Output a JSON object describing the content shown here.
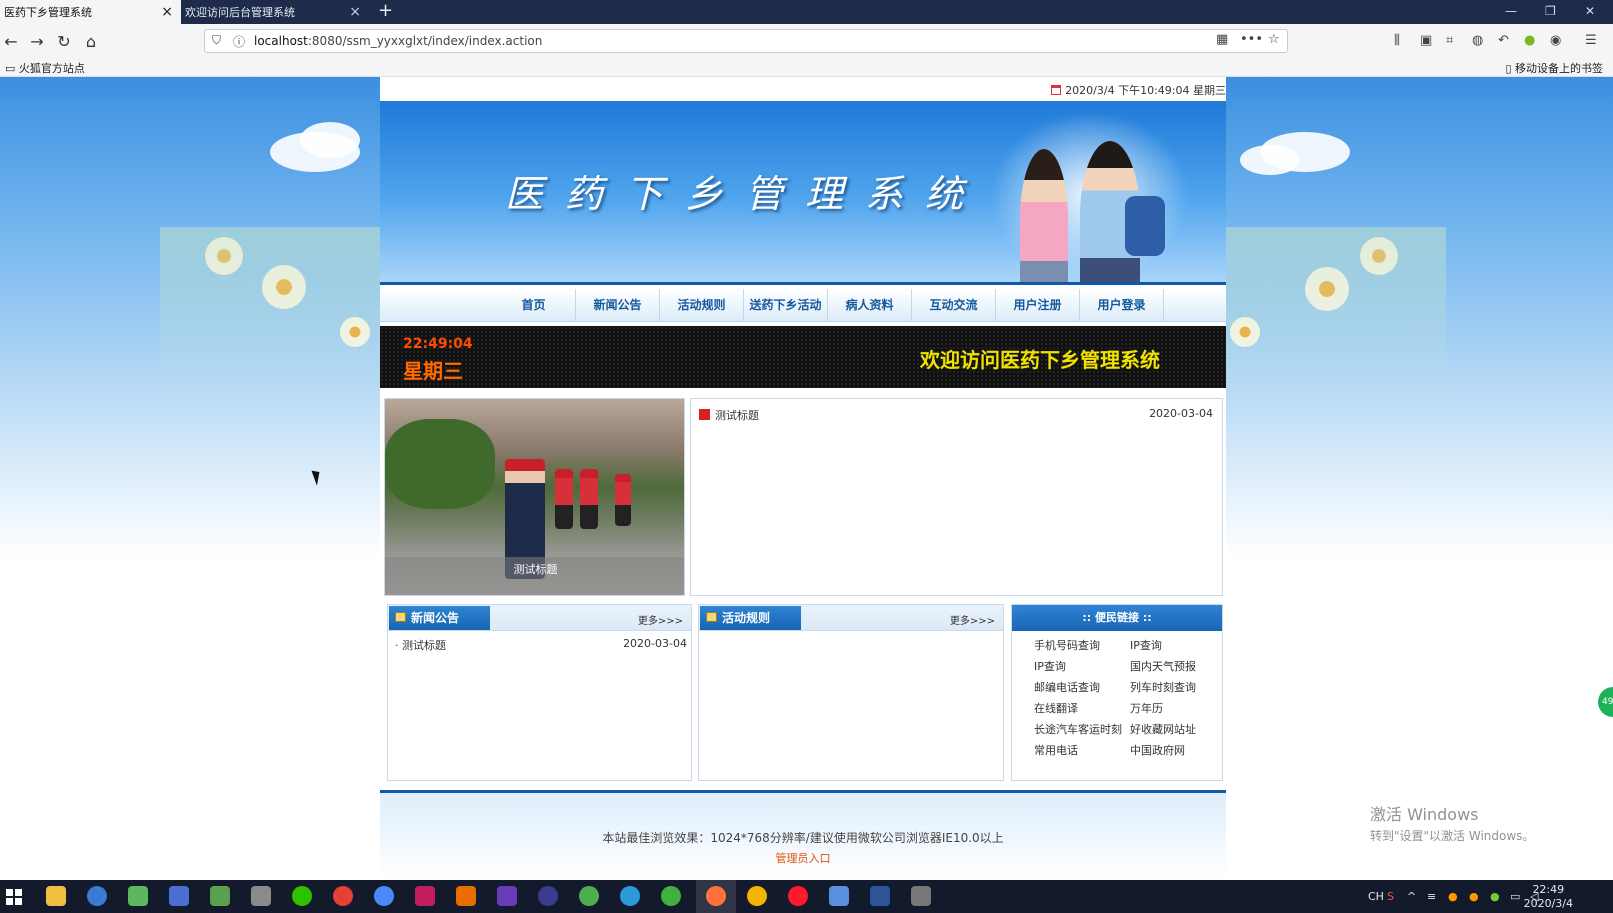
{
  "browser": {
    "tabs": [
      {
        "title": "医药下乡管理系统",
        "active": true
      },
      {
        "title": "欢迎访问后台管理系统",
        "active": false
      }
    ],
    "new_tab": "+",
    "url_host": "localhost",
    "url_rest": ":8080/ssm_yyxxglxt/index/index.action",
    "bookmarks_left": "火狐官方站点",
    "bookmarks_right": "移动设备上的书签"
  },
  "site": {
    "datetime": "2020/3/4 下午10:49:04 星期三",
    "banner_title": "医药下乡管理系统",
    "menu": [
      "首页",
      "新闻公告",
      "活动规则",
      "送药下乡活动",
      "病人资料",
      "互动交流",
      "用户注册",
      "用户登录"
    ],
    "led": {
      "time": "22:49:04",
      "day": "星期三",
      "welcome": "欢迎访问医药下乡管理系统"
    },
    "featured": {
      "caption": "测试标题"
    },
    "news_main": [
      {
        "title": "测试标题",
        "date": "2020-03-04"
      }
    ],
    "panels": {
      "news": {
        "title": "新闻公告",
        "more": "更多>>>",
        "items": [
          {
            "title": "测试标题",
            "date": "2020-03-04"
          }
        ]
      },
      "rules": {
        "title": "活动规则",
        "more": "更多>>>",
        "items": []
      }
    },
    "links": {
      "title": ":: 便民链接 ::",
      "items": [
        "手机号码查询",
        "IP查询",
        "IP查询",
        "国内天气预报",
        "邮编电话查询",
        "列车时刻查询",
        "在线翻译",
        "万年历",
        "长途汽车客运时刻",
        "好收藏网站址",
        "常用电话",
        "中国政府网"
      ]
    },
    "footer": {
      "text": "本站最佳浏览效果：1024*768分辨率/建议使用微软公司浏览器IE10.0以上",
      "admin": "管理员入口"
    }
  },
  "overlay": {
    "activate_title": "激活 Windows",
    "activate_sub": "转到\"设置\"以激活 Windows。",
    "side_badge": "49"
  },
  "taskbar": {
    "time": "22:49",
    "date": "2020/3/4",
    "ime": "CH"
  },
  "colors": {
    "accent": "#1766b4",
    "led_orange": "#ff6a00",
    "led_yellow": "#f2e200",
    "admin_link": "#e0540a"
  }
}
